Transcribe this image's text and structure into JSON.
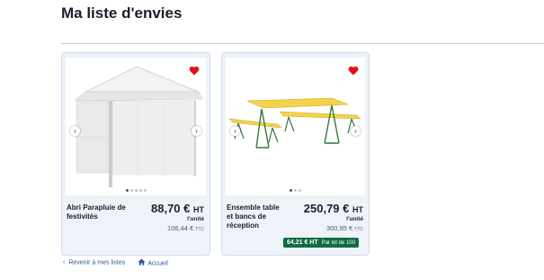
{
  "page": {
    "title": "Ma liste d'envies"
  },
  "colors": {
    "heart": "#e3101a",
    "badge": "#0f6b43",
    "link": "#2f5496"
  },
  "products": [
    {
      "name": "Abri Parapluie de festivités",
      "price": "88,70 €",
      "price_suffix": "HT",
      "unit": "l'unité",
      "price_ttc": "106,44 €",
      "ttc_label": "TTC",
      "image": "tent-icon",
      "slides": 5,
      "active_slide": 1
    },
    {
      "name": "Ensemble table et bancs de réception",
      "price": "250,79 €",
      "price_suffix": "HT",
      "unit": "l'unité",
      "price_ttc": "300,95 €",
      "ttc_label": "TTC",
      "image": "beer-table-icon",
      "slides": 3,
      "active_slide": 1,
      "lot_badge": {
        "price": "64,21 € HT",
        "text": "Par lot de 100"
      }
    }
  ],
  "footer": {
    "back_link": "Revenir à mes listes",
    "home_link": "Accueil"
  }
}
